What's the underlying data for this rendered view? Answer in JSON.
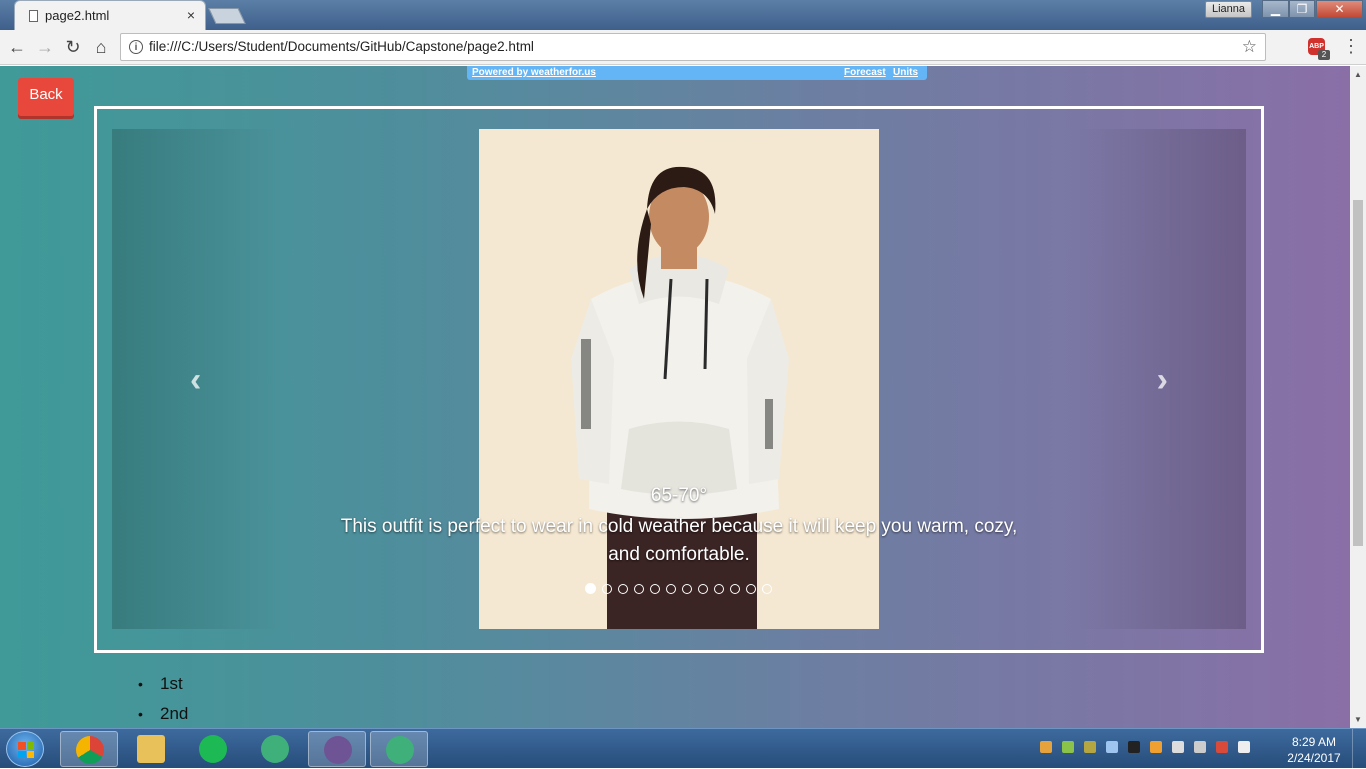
{
  "browser": {
    "tab_title": "page2.html",
    "tab_close": "×",
    "user_name": "Lianna",
    "window_min": "▁",
    "window_max": "❐",
    "window_close": "✕",
    "url": "file:///C:/Users/Student/Documents/GitHub/Capstone/page2.html",
    "info_glyph": "i",
    "star_glyph": "☆",
    "abp_label": "ABP",
    "abp_count": "2",
    "menu_glyph": "⋮",
    "back_glyph": "←",
    "forward_glyph": "→",
    "reload_glyph": "↻",
    "home_glyph": "⌂"
  },
  "weather_widget": {
    "powered_by": "Powered by weatherfor.us",
    "forecast": "Forecast",
    "units": "Units"
  },
  "page": {
    "back_button": "Back",
    "carousel": {
      "prev_glyph": "‹",
      "next_glyph": "›",
      "temperature": "65-70°",
      "description": "This outfit is perfect to wear in cold weather because it will keep you warm, cozy, and comfortable.",
      "slide_count": 12,
      "active_slide_index": 0
    },
    "list_items": [
      "1st",
      "2nd"
    ]
  },
  "taskbar": {
    "time": "8:29 AM",
    "date": "2/24/2017",
    "apps": [
      "chrome-icon",
      "file-explorer-icon",
      "spotify-icon",
      "atom-icon",
      "github-desktop-icon",
      "atom-icon"
    ]
  },
  "colors": {
    "page_gradient_start": "#3f9a98",
    "page_gradient_end": "#8a6fa7",
    "back_button": "#e8483c",
    "weather_bar": "#63b5f6"
  }
}
